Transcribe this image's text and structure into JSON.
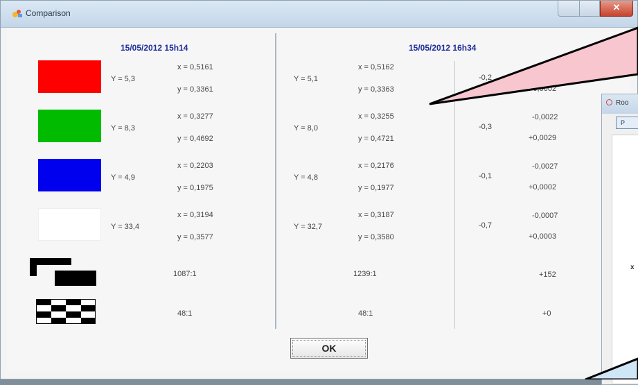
{
  "window": {
    "title": "Comparison"
  },
  "columns": {
    "left_header": "15/05/2012 15h14",
    "right_header": "15/05/2012 16h34"
  },
  "colors": {
    "red": "#ff0000",
    "green": "#00bb00",
    "blue": "#0000ee",
    "white": "#ffffff",
    "callout_pink": "#f7c6cf",
    "callout_blue": "#cfe6f7",
    "header_text": "#1f2f9a"
  },
  "rows": [
    {
      "swatch": "red-swatch",
      "left_Y": "Y = 5,3",
      "left_x": "x = 0,5161",
      "left_y": "y = 0,3361",
      "right_Y": "Y = 5,1",
      "right_x": "x = 0,5162",
      "right_y": "y = 0,3363",
      "diff_Y": "-0,2",
      "diff_x": "",
      "diff_y": "+0,0002"
    },
    {
      "swatch": "green-swatch",
      "left_Y": "Y = 8,3",
      "left_x": "x = 0,3277",
      "left_y": "y = 0,4692",
      "right_Y": "Y = 8,0",
      "right_x": "x = 0,3255",
      "right_y": "y = 0,4721",
      "diff_Y": "-0,3",
      "diff_x": "-0,0022",
      "diff_y": "+0,0029"
    },
    {
      "swatch": "blue-swatch",
      "left_Y": "Y = 4,9",
      "left_x": "x = 0,2203",
      "left_y": "y = 0,1975",
      "right_Y": "Y = 4,8",
      "right_x": "x = 0,2176",
      "right_y": "y = 0,1977",
      "diff_Y": "-0,1",
      "diff_x": "-0,0027",
      "diff_y": "+0,0002"
    },
    {
      "swatch": "white-swatch",
      "left_Y": "Y = 33,4",
      "left_x": "x = 0,3194",
      "left_y": "y = 0,3577",
      "right_Y": "Y = 32,7",
      "right_x": "x = 0,3187",
      "right_y": "y = 0,3580",
      "diff_Y": "-0,7",
      "diff_x": "-0,0007",
      "diff_y": "+0,0003"
    }
  ],
  "contrast": {
    "full_on_off": {
      "left": "1087:1",
      "right": "1239:1",
      "diff": "+152"
    },
    "ansi": {
      "left": "48:1",
      "right": "48:1",
      "diff": "+0"
    }
  },
  "buttons": {
    "ok_label": "OK"
  },
  "background_window": {
    "title": "Roo",
    "button_label": "P",
    "marker": "x"
  },
  "icons": [
    "app-icon",
    "minimize-icon",
    "maximize-icon",
    "close-icon",
    "full-on-off-contrast-icon",
    "checkerboard-contrast-icon"
  ]
}
